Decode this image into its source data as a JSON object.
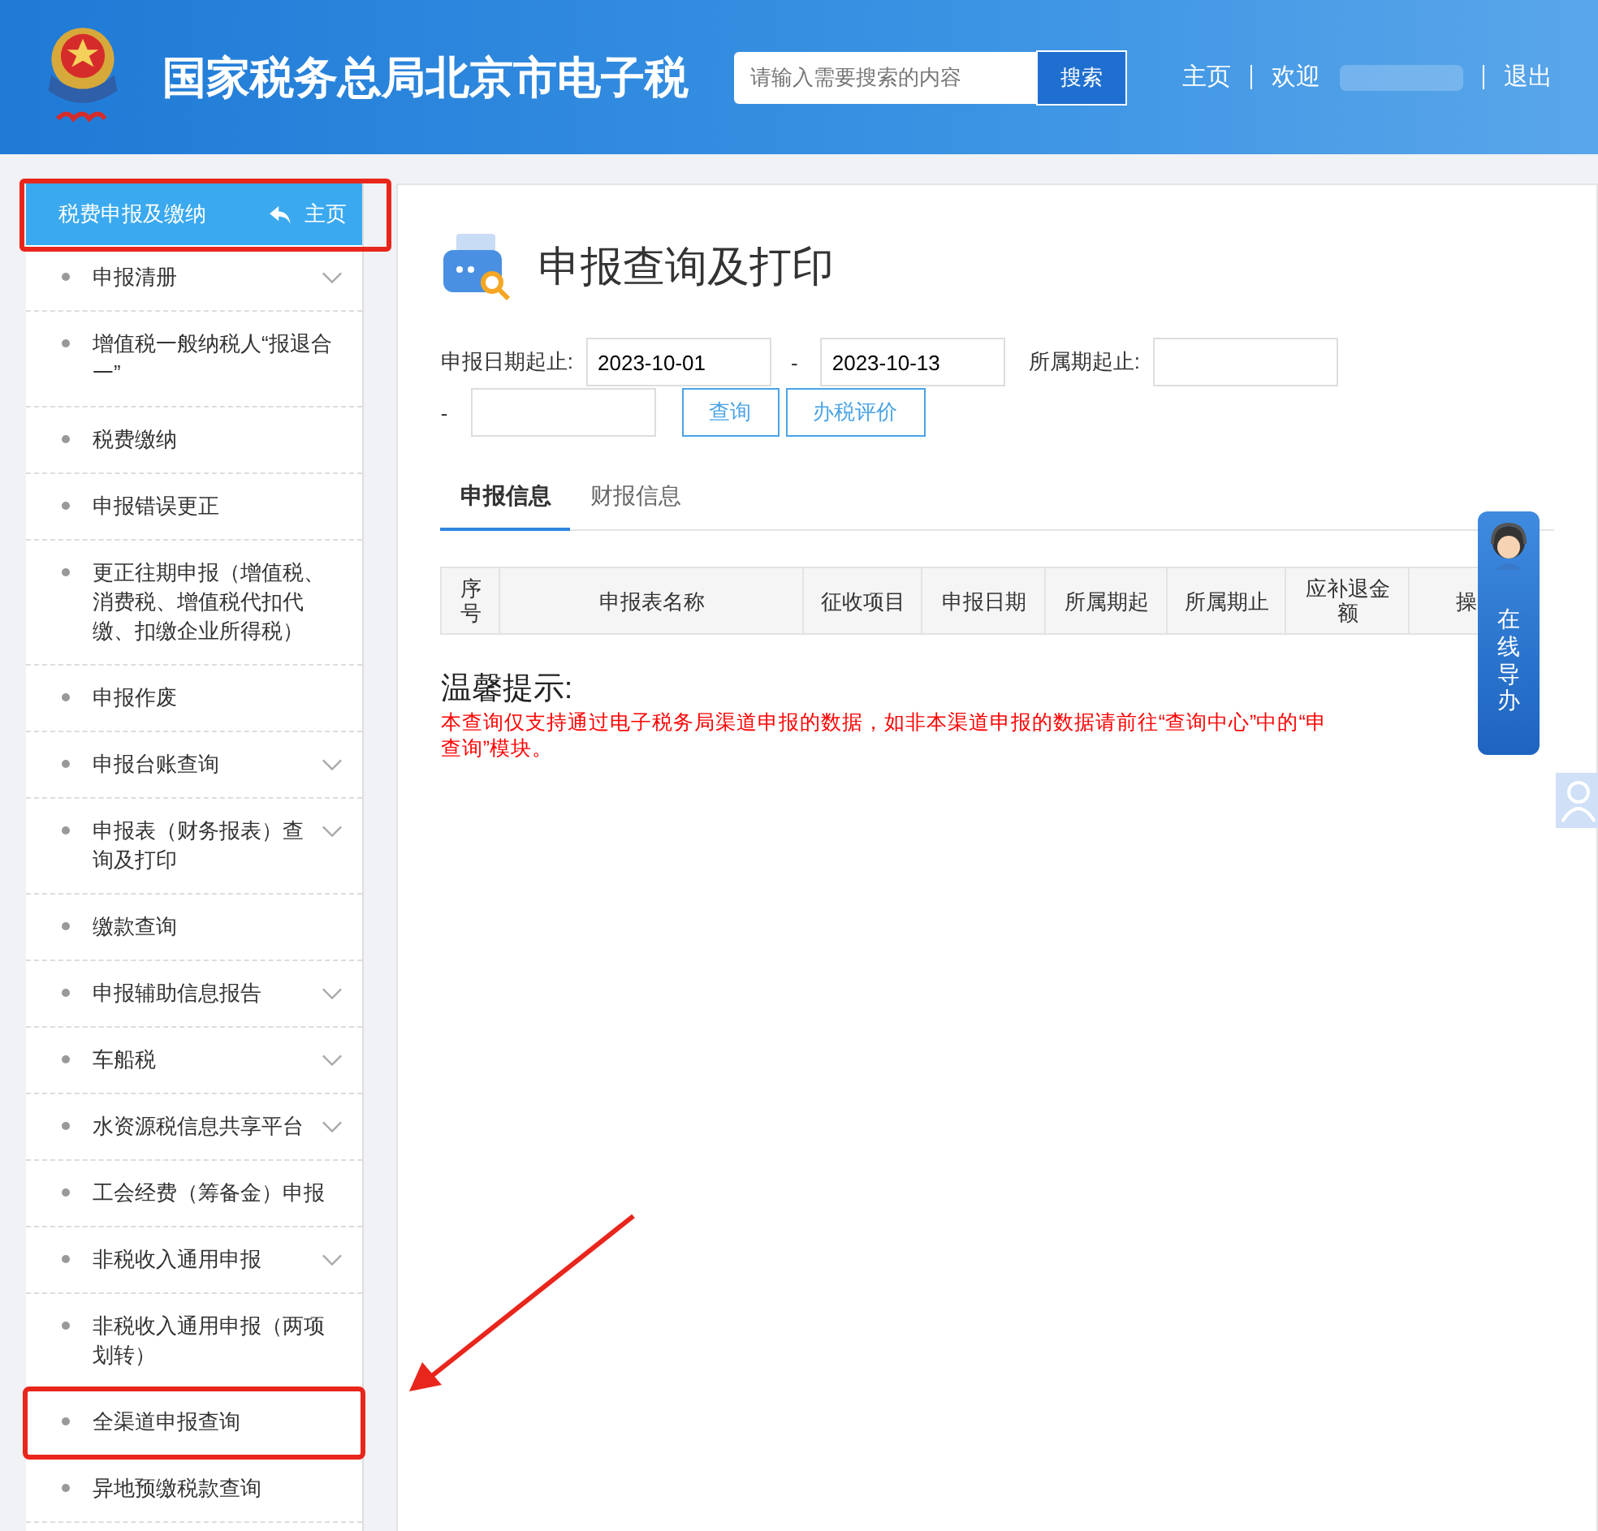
{
  "header": {
    "title": "国家税务总局北京市电子税",
    "search": {
      "placeholder": "请输入需要搜索的内容",
      "button": "搜索"
    },
    "nav": [
      "主页",
      "欢迎",
      "退出"
    ]
  },
  "sidebar": {
    "title": "税费申报及缴纳",
    "home": "主页",
    "items": [
      {
        "label": "申报清册",
        "expandable": true,
        "highlighted": false
      },
      {
        "label": "增值税一般纳税人“报退合一”",
        "expandable": false,
        "highlighted": false
      },
      {
        "label": "税费缴纳",
        "expandable": false,
        "highlighted": false
      },
      {
        "label": "申报错误更正",
        "expandable": false,
        "highlighted": false
      },
      {
        "label": "更正往期申报（增值税、消费税、增值税代扣代缴、扣缴企业所得税）",
        "expandable": false,
        "highlighted": false
      },
      {
        "label": "申报作废",
        "expandable": false,
        "highlighted": false
      },
      {
        "label": "申报台账查询",
        "expandable": true,
        "highlighted": false
      },
      {
        "label": "申报表（财务报表）查询及打印",
        "expandable": true,
        "highlighted": false
      },
      {
        "label": "缴款查询",
        "expandable": false,
        "highlighted": false
      },
      {
        "label": "申报辅助信息报告",
        "expandable": true,
        "highlighted": false
      },
      {
        "label": "车船税",
        "expandable": true,
        "highlighted": false
      },
      {
        "label": "水资源税信息共享平台",
        "expandable": true,
        "highlighted": false
      },
      {
        "label": "工会经费（筹备金）申报",
        "expandable": false,
        "highlighted": false
      },
      {
        "label": "非税收入通用申报",
        "expandable": true,
        "highlighted": false
      },
      {
        "label": "非税收入通用申报（两项划转）",
        "expandable": false,
        "highlighted": false
      },
      {
        "label": "全渠道申报查询",
        "expandable": false,
        "highlighted": true
      },
      {
        "label": "异地预缴税款查询",
        "expandable": false,
        "highlighted": false
      }
    ]
  },
  "main": {
    "title": "申报查询及打印",
    "form": {
      "date_label": "申报日期起止:",
      "date_from": "2023-10-01",
      "separator": "-",
      "date_to": "2023-10-13",
      "period_label": "所属期起止:",
      "period_separator": "-",
      "buttons": [
        "查询",
        "办税评价"
      ]
    },
    "tabs": [
      {
        "label": "申报信息",
        "selected": true
      },
      {
        "label": "财报信息",
        "selected": false
      }
    ],
    "table": {
      "columns": [
        "序号",
        "申报表名称",
        "征收项目",
        "申报日期",
        "所属期起",
        "所属期止",
        "应补退金额",
        "操"
      ]
    },
    "notice": {
      "title": "温馨提示:",
      "lines": [
        "本查询仅支持通过电子税务局渠道申报的数据，如非本渠道申报的数据请前往“查询中心”中的“申",
        "查询”模块。"
      ]
    }
  },
  "guide": {
    "label": "在线导办"
  }
}
